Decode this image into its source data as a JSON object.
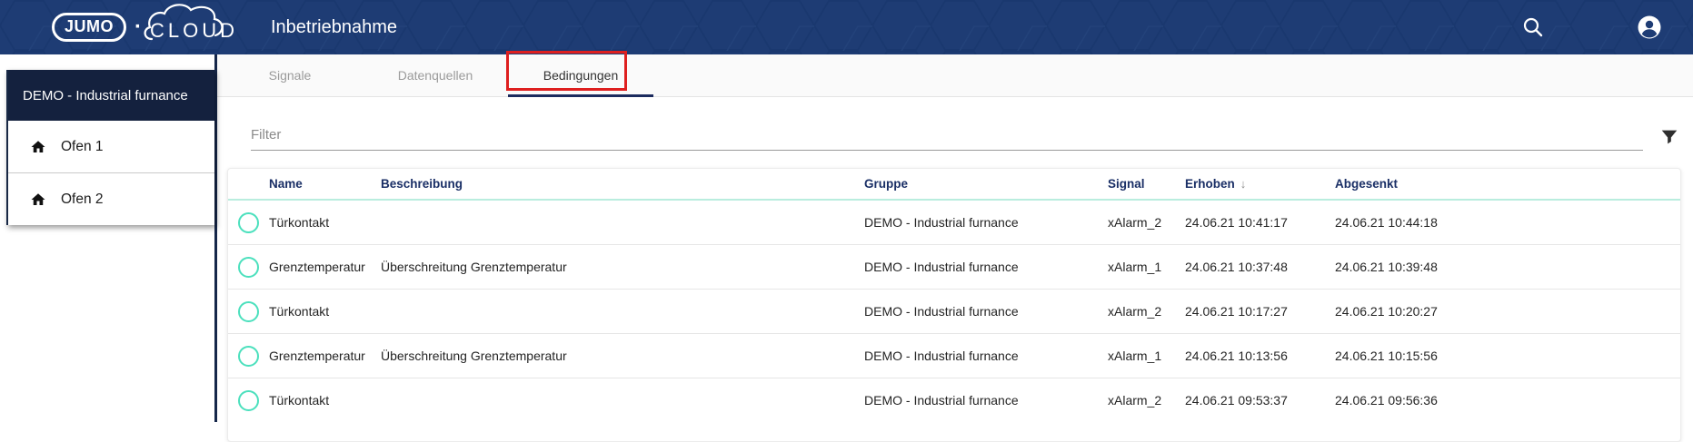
{
  "header": {
    "logo": {
      "brand": "JUMO",
      "separator": "·",
      "suffix": "CLOUD"
    },
    "title": "Inbetriebnahme",
    "icons": {
      "search": "search-icon",
      "account": "account-circle-icon"
    }
  },
  "sidebar": {
    "project": "DEMO - Industrial furnance",
    "items": [
      {
        "label": "Ofen 1",
        "icon": "home-icon"
      },
      {
        "label": "Ofen 2",
        "icon": "home-icon"
      }
    ]
  },
  "tabs": [
    {
      "label": "Signale",
      "active": false
    },
    {
      "label": "Datenquellen",
      "active": false
    },
    {
      "label": "Bedingungen",
      "active": true,
      "annotated": true
    }
  ],
  "filter": {
    "placeholder": "Filter",
    "icon": "funnel-icon"
  },
  "table": {
    "columns": [
      "Name",
      "Beschreibung",
      "Gruppe",
      "Signal",
      "Erhoben",
      "Abgesenkt"
    ],
    "sort": {
      "column": "Erhoben",
      "direction": "desc",
      "glyph": "↓"
    },
    "status_icon": "circle-ring-icon",
    "rows": [
      {
        "name": "Türkontakt",
        "beschreibung": "",
        "gruppe": "DEMO - Industrial furnance",
        "signal": "xAlarm_2",
        "erhoben": "24.06.21 10:41:17",
        "abgesenkt": "24.06.21 10:44:18"
      },
      {
        "name": "Grenztemperatur",
        "beschreibung": "Überschreitung Grenztemperatur",
        "gruppe": "DEMO - Industrial furnance",
        "signal": "xAlarm_1",
        "erhoben": "24.06.21 10:37:48",
        "abgesenkt": "24.06.21 10:39:48"
      },
      {
        "name": "Türkontakt",
        "beschreibung": "",
        "gruppe": "DEMO - Industrial furnance",
        "signal": "xAlarm_2",
        "erhoben": "24.06.21 10:17:27",
        "abgesenkt": "24.06.21 10:20:27"
      },
      {
        "name": "Grenztemperatur",
        "beschreibung": "Überschreitung Grenztemperatur",
        "gruppe": "DEMO - Industrial furnance",
        "signal": "xAlarm_1",
        "erhoben": "24.06.21 10:13:56",
        "abgesenkt": "24.06.21 10:15:56"
      },
      {
        "name": "Türkontakt",
        "beschreibung": "",
        "gruppe": "DEMO - Industrial furnance",
        "signal": "xAlarm_2",
        "erhoben": "24.06.21 09:53:37",
        "abgesenkt": "24.06.21 09:56:36"
      }
    ]
  },
  "colors": {
    "header_bg": "#1e3c74",
    "sidebar_header_bg": "#14213e",
    "accent_teal": "#4be0bd",
    "annotation_red": "#de1f1f",
    "tab_indicator": "#1b2b5e",
    "table_header_text": "#1a2f66"
  }
}
